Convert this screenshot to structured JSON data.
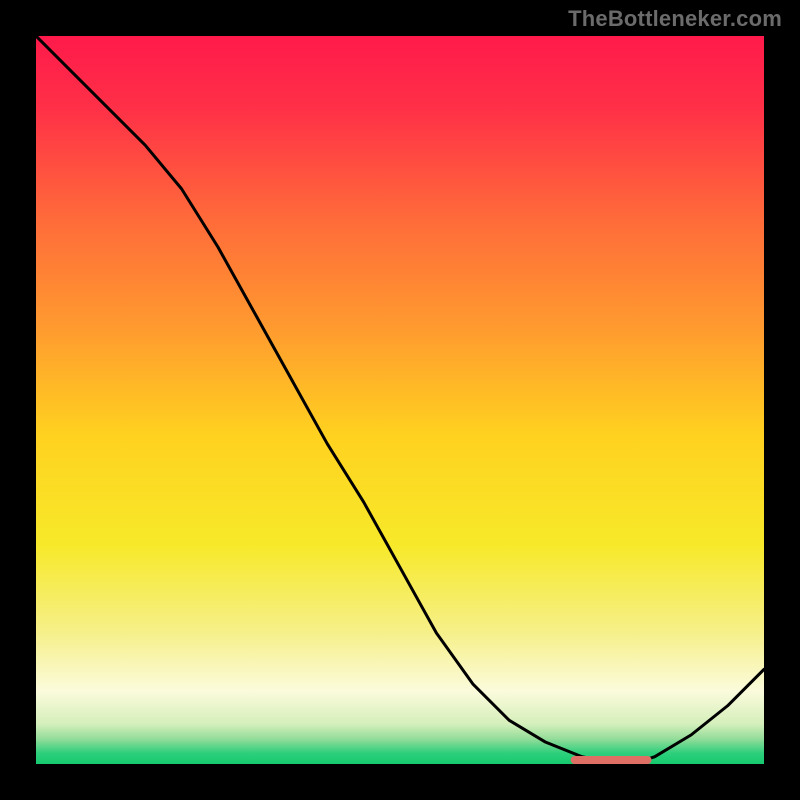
{
  "attribution": "TheBottleneker.com",
  "chart_data": {
    "type": "line",
    "title": "",
    "xlabel": "",
    "ylabel": "",
    "xlim": [
      0,
      100
    ],
    "ylim": [
      0,
      100
    ],
    "x": [
      0,
      5,
      10,
      15,
      20,
      25,
      30,
      35,
      40,
      45,
      50,
      55,
      60,
      65,
      70,
      75,
      80,
      82,
      85,
      90,
      95,
      100
    ],
    "values": [
      100,
      95,
      90,
      85,
      79,
      71,
      62,
      53,
      44,
      36,
      27,
      18,
      11,
      6,
      3,
      1,
      0,
      0,
      1,
      4,
      8,
      13
    ],
    "annotations": [
      {
        "kind": "flat-segment",
        "x_start": 74,
        "x_end": 84,
        "y": 0,
        "color": "#dd6f65"
      }
    ],
    "background": {
      "type": "vertical-gradient",
      "stops": [
        {
          "pos": 0.0,
          "color": "#ff1a4b"
        },
        {
          "pos": 0.1,
          "color": "#ff3047"
        },
        {
          "pos": 0.25,
          "color": "#ff6a3a"
        },
        {
          "pos": 0.4,
          "color": "#ff9a2f"
        },
        {
          "pos": 0.55,
          "color": "#ffd21f"
        },
        {
          "pos": 0.7,
          "color": "#f7e92a"
        },
        {
          "pos": 0.82,
          "color": "#f6f08a"
        },
        {
          "pos": 0.9,
          "color": "#fbfbdc"
        },
        {
          "pos": 0.945,
          "color": "#d5efbb"
        },
        {
          "pos": 0.965,
          "color": "#95dd9a"
        },
        {
          "pos": 0.985,
          "color": "#2ecf7c"
        },
        {
          "pos": 1.0,
          "color": "#14c96e"
        }
      ]
    }
  }
}
